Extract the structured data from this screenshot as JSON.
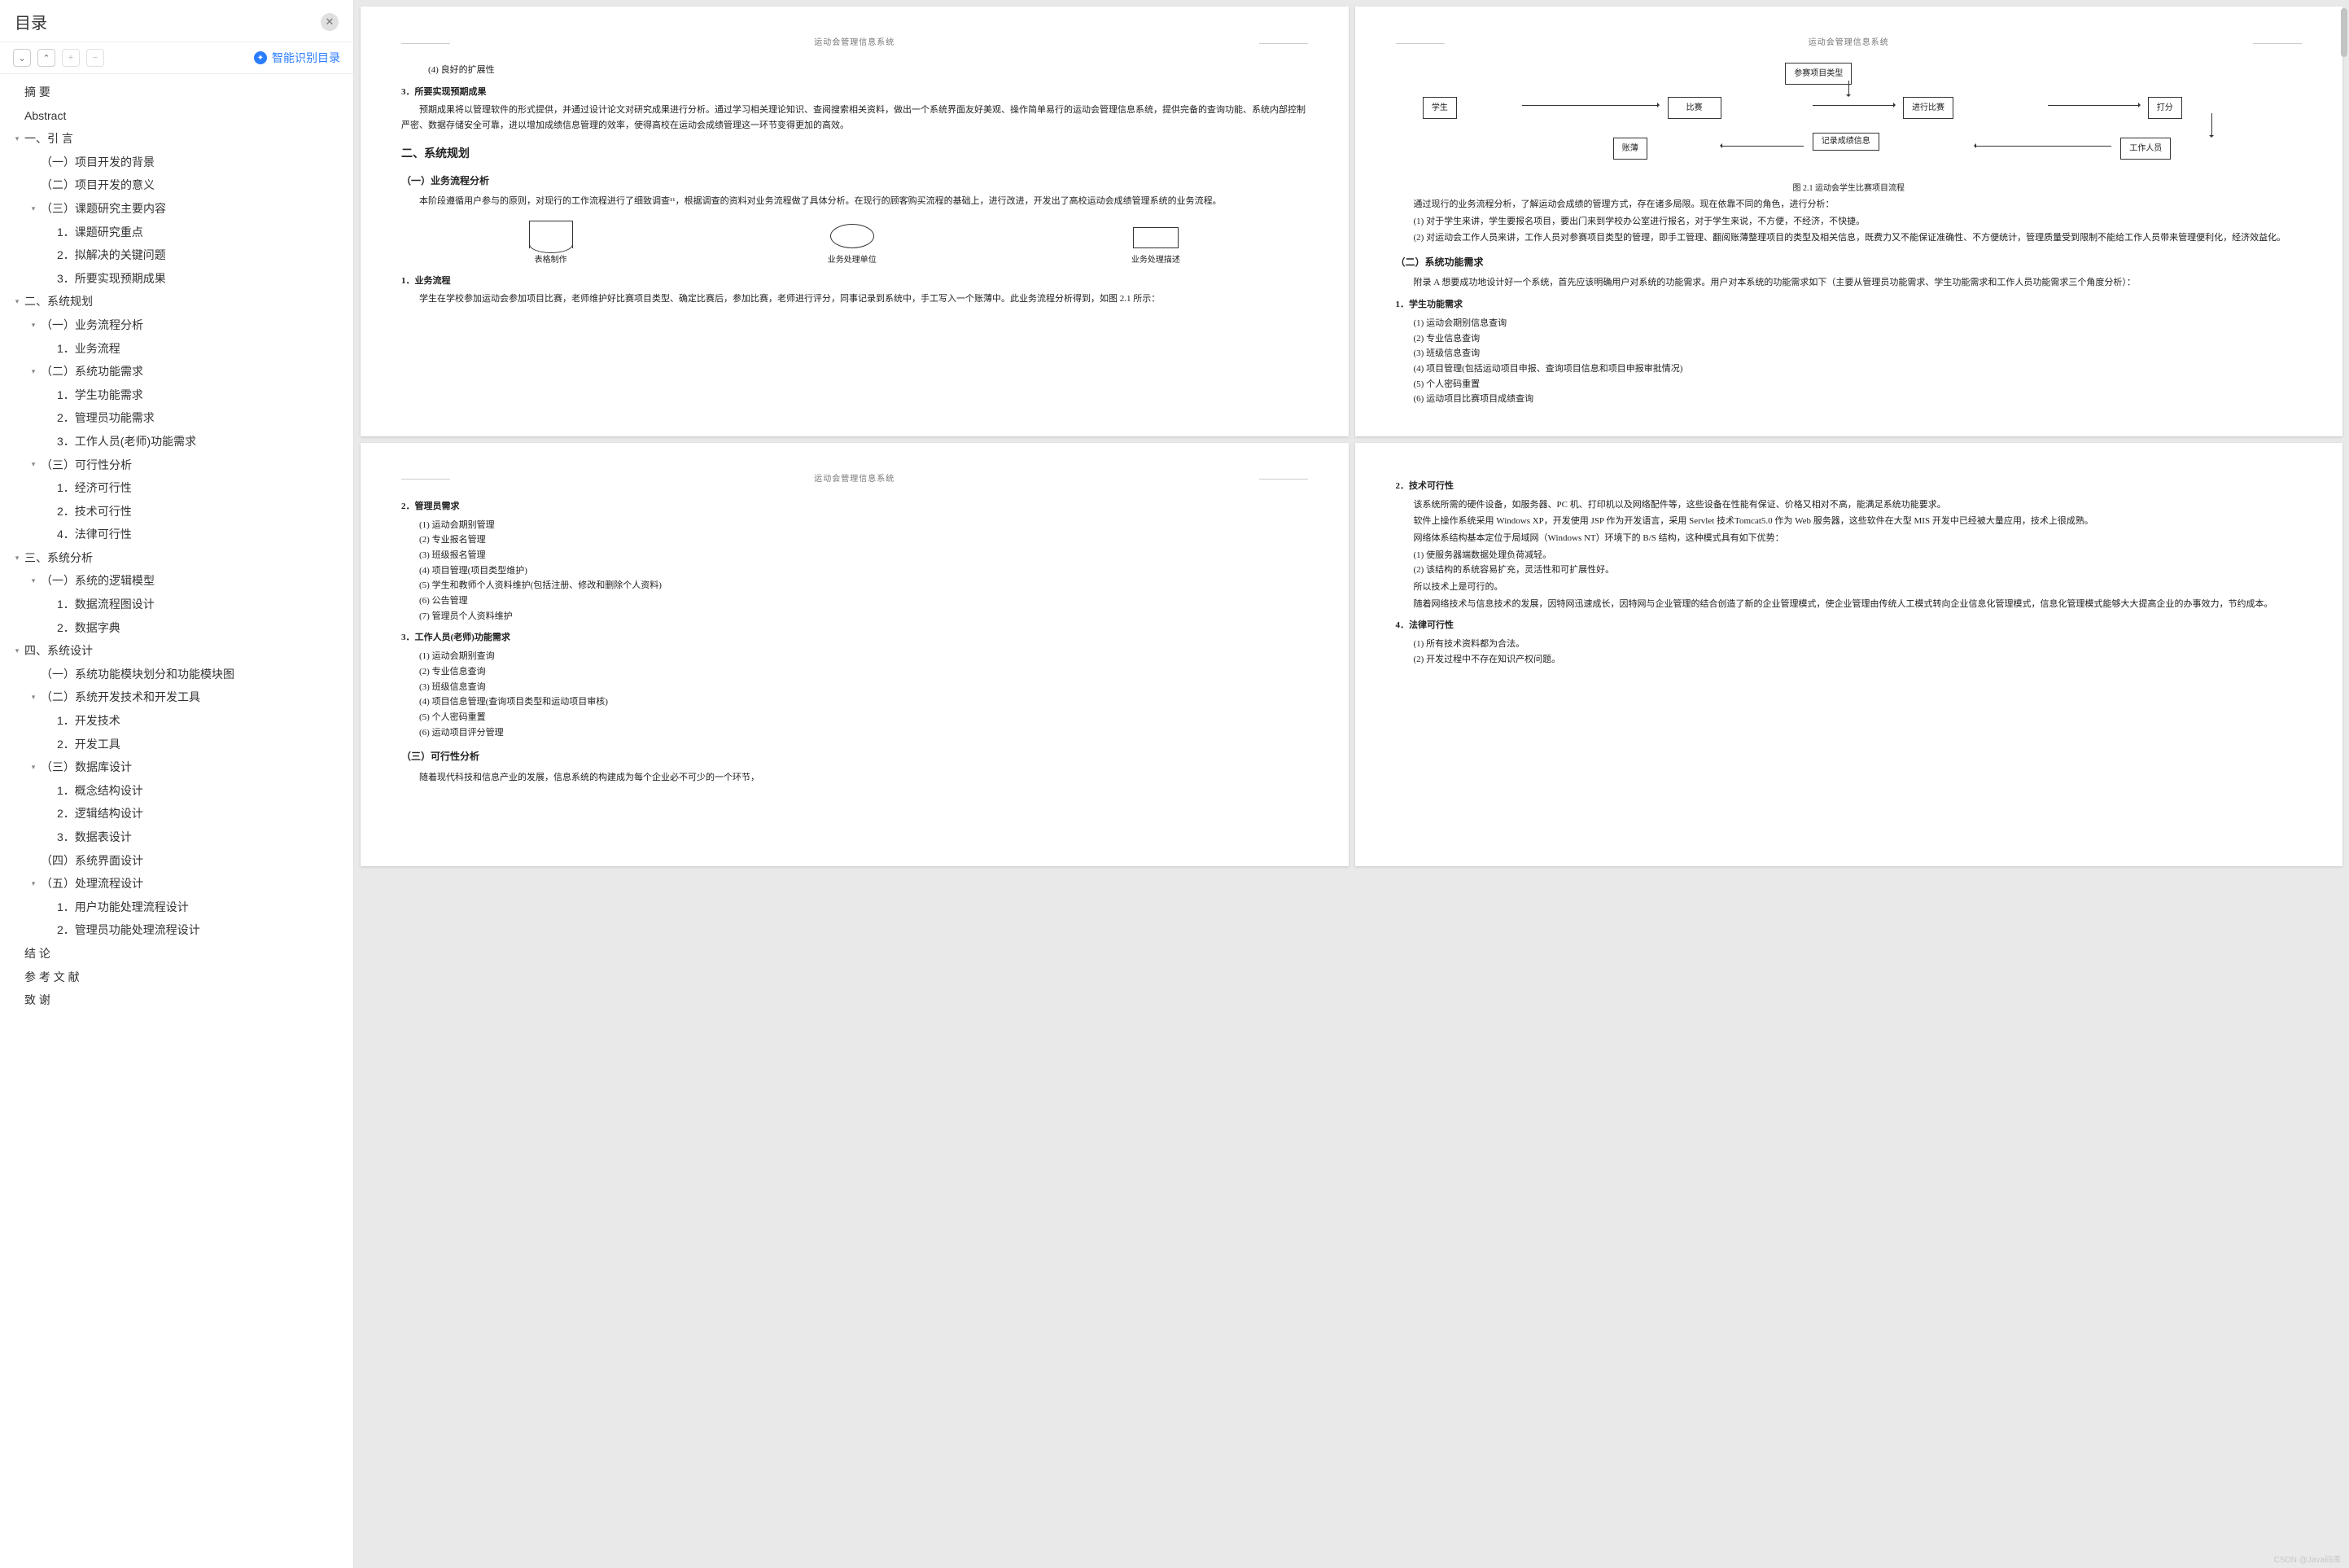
{
  "sidebar": {
    "title": "目录",
    "close_tip": "关闭",
    "smart_link": "智能识别目录",
    "toolbar_icons": {
      "collapse": "⌄",
      "up": "⌃",
      "plus": "+",
      "minus": "−"
    }
  },
  "toc": [
    {
      "label": "摘    要",
      "level": 0,
      "leaf": true,
      "id": "t0"
    },
    {
      "label": "Abstract",
      "level": 0,
      "leaf": true,
      "id": "t1"
    },
    {
      "label": "一、引   言",
      "level": 0,
      "id": "t2",
      "children": [
        {
          "label": "（一）项目开发的背景",
          "leaf": true,
          "id": "t2a"
        },
        {
          "label": "（二）项目开发的意义",
          "leaf": true,
          "id": "t2b"
        },
        {
          "label": "（三）课题研究主要内容",
          "id": "t2c",
          "children": [
            {
              "label": "1．课题研究重点",
              "leaf": true,
              "id": "t2c1"
            },
            {
              "label": "2．拟解决的关键问题",
              "leaf": true,
              "id": "t2c2"
            },
            {
              "label": "3．所要实现预期成果",
              "leaf": true,
              "id": "t2c3"
            }
          ]
        }
      ]
    },
    {
      "label": "二、系统规划",
      "level": 0,
      "id": "t3",
      "children": [
        {
          "label": "（一）业务流程分析",
          "id": "t3a",
          "children": [
            {
              "label": "1．业务流程",
              "leaf": true,
              "id": "t3a1"
            }
          ]
        },
        {
          "label": "（二）系统功能需求",
          "id": "t3b",
          "children": [
            {
              "label": "1．学生功能需求",
              "leaf": true,
              "id": "t3b1"
            },
            {
              "label": "2．管理员功能需求",
              "leaf": true,
              "id": "t3b2"
            },
            {
              "label": "3．工作人员(老师)功能需求",
              "leaf": true,
              "id": "t3b3"
            }
          ]
        },
        {
          "label": "（三）可行性分析",
          "id": "t3c",
          "children": [
            {
              "label": "1．经济可行性",
              "leaf": true,
              "id": "t3c1"
            },
            {
              "label": "2．技术可行性",
              "leaf": true,
              "id": "t3c2"
            },
            {
              "label": "4．法律可行性",
              "leaf": true,
              "id": "t3c4"
            }
          ]
        }
      ]
    },
    {
      "label": "三、系统分析",
      "level": 0,
      "id": "t4",
      "children": [
        {
          "label": "（一）系统的逻辑模型",
          "id": "t4a",
          "children": [
            {
              "label": "1．数据流程图设计",
              "leaf": true,
              "id": "t4a1"
            },
            {
              "label": "2．数据字典",
              "leaf": true,
              "id": "t4a2"
            }
          ]
        }
      ]
    },
    {
      "label": "四、系统设计",
      "level": 0,
      "id": "t5",
      "children": [
        {
          "label": "（一）系统功能模块划分和功能模块图",
          "leaf": true,
          "id": "t5a"
        },
        {
          "label": "（二）系统开发技术和开发工具",
          "id": "t5b",
          "children": [
            {
              "label": "1．开发技术",
              "leaf": true,
              "id": "t5b1"
            },
            {
              "label": "2．开发工具",
              "leaf": true,
              "id": "t5b2"
            }
          ]
        },
        {
          "label": "（三）数据库设计",
          "id": "t5c",
          "children": [
            {
              "label": "1．概念结构设计",
              "leaf": true,
              "id": "t5c1"
            },
            {
              "label": "2．逻辑结构设计",
              "leaf": true,
              "id": "t5c2"
            },
            {
              "label": "3．数据表设计",
              "leaf": true,
              "id": "t5c3"
            }
          ]
        },
        {
          "label": "（四）系统界面设计",
          "leaf": true,
          "id": "t5d"
        },
        {
          "label": "（五）处理流程设计",
          "id": "t5e",
          "children": [
            {
              "label": "1．用户功能处理流程设计",
              "leaf": true,
              "id": "t5e1"
            },
            {
              "label": "2．管理员功能处理流程设计",
              "leaf": true,
              "id": "t5e2"
            }
          ]
        }
      ]
    },
    {
      "label": "结    论",
      "level": 0,
      "leaf": true,
      "id": "t6"
    },
    {
      "label": "参 考 文 献",
      "level": 0,
      "leaf": true,
      "id": "t7"
    },
    {
      "label": "致    谢",
      "level": 0,
      "leaf": true,
      "id": "t8"
    }
  ],
  "doc_header": "运动会管理信息系统",
  "page1": {
    "line_top": "(4) 良好的扩展性",
    "h3a": "3．所要实现预期成果",
    "p1": "预期成果将以管理软件的形式提供，并通过设计论文对研究成果进行分析。通过学习相关理论知识、查阅搜索相关资料，做出一个系统界面友好美观、操作简单易行的运动会管理信息系统，提供完备的查询功能、系统内部控制严密、数据存储安全可靠，进以增加成绩信息管理的效率，使得高校在运动会成绩管理这一环节变得更加的高效。",
    "h2": "二、系统规划",
    "h3b": "（一）业务流程分析",
    "p2": "本阶段遵循用户参与的原则，对现行的工作流程进行了细致调查¹¹，根据调查的资料对业务流程做了具体分析。在现行的顾客购买流程的基础上，进行改进，开发出了高校运动会成绩管理系统的业务流程。",
    "shapes": {
      "a": "表格制作",
      "b": "业务处理单位",
      "c": "业务处理描述"
    },
    "h4": "1．业务流程",
    "p3": "学生在学校参加运动会参加项目比赛，老师维护好比赛项目类型、确定比赛后，参加比赛，老师进行评分，同事记录到系统中，手工写入一个账薄中。此业务流程分析得到，如图 2.1 所示：",
    "corners": true
  },
  "page2": {
    "flow": {
      "top": "参赛项目类型",
      "l1": "学生",
      "l2": "比赛",
      "l3": "进行比赛",
      "l4": "打分",
      "b1": "账薄",
      "b2": "记录成绩信息",
      "b3": "工作人员",
      "caption": "图 2.1 运动会学生比赛项目流程"
    },
    "p1": "通过现行的业务流程分析，了解运动会成绩的管理方式，存在诸多局限。现在依靠不同的角色，进行分析：",
    "li1": "(1) 对于学生来讲，学生要报名项目，要出门来到学校办公室进行报名，对于学生来说，不方便，不经济，不快捷。",
    "li2": "(2) 对运动会工作人员来讲，工作人员对参赛项目类型的管理，即手工管理、翻阅账薄整理项目的类型及相关信息，既费力又不能保证准确性、不方便统计，管理质量受到限制不能给工作人员带来管理便利化，经济效益化。",
    "h3": "（二）系统功能需求",
    "p2": "附录 A 想要成功地设计好一个系统，首先应该明确用户对系统的功能需求。用户对本系统的功能需求如下（主要从管理员功能需求、学生功能需求和工作人员功能需求三个角度分析）：",
    "h4": "1．学生功能需求",
    "ol": [
      "(1) 运动会期别信息查询",
      "(2) 专业信息查询",
      "(3) 班级信息查询",
      "(4) 项目管理(包括运动项目申报、查询项目信息和项目申报审批情况)",
      "(5) 个人密码重置",
      "(6) 运动项目比赛项目成绩查询"
    ],
    "corners": true
  },
  "page3": {
    "h4a": "2．管理员需求",
    "ol_a": [
      "(1) 运动会期别管理",
      "(2) 专业报名管理",
      "(3) 班级报名管理",
      "(4) 项目管理(项目类型维护)",
      "(5) 学生和教师个人资料维护(包括注册、修改和删除个人资料)",
      "(6) 公告管理",
      "(7) 管理员个人资料维护"
    ],
    "h4b": "3．工作人员(老师)功能需求",
    "ol_b": [
      "(1) 运动会期别查询",
      "(2) 专业信息查询",
      "(3) 班级信息查询",
      "(4) 项目信息管理(查询项目类型和运动项目审核)",
      "(5) 个人密码重置",
      "(6) 运动项目评分管理"
    ],
    "h3": "（三）可行性分析",
    "p1": "随着现代科技和信息产业的发展，信息系统的构建成为每个企业必不可少的一个环节，"
  },
  "page4": {
    "h4a": "2．技术可行性",
    "p1": "该系统所需的硬件设备，如服务器、PC 机、打印机以及网络配件等，这些设备在性能有保证、价格又相对不高，能满足系统功能要求。",
    "p2": "软件上操作系统采用 Windows XP，开发使用 JSP 作为开发语言，采用 Servlet 技术Tomcat5.0 作为 Web 服务器，这些软件在大型 MIS 开发中已经被大量应用，技术上很成熟。",
    "p3": "网络体系结构基本定位于局域网（Windows NT）环境下的 B/S 结构，这种模式具有如下优势：",
    "ol_a": [
      "(1) 使服务器端数据处理负荷减轻。",
      "(2) 该结构的系统容易扩充，灵活性和可扩展性好。"
    ],
    "p4": "所以技术上是可行的。",
    "p5": "随着网络技术与信息技术的发展，因特网迅速成长，因特网与企业管理的结合创造了新的企业管理模式，使企业管理由传统人工模式转向企业信息化管理模式，信息化管理模式能够大大提高企业的办事效力，节约成本。",
    "h4b": "4．法律可行性",
    "ol_b": [
      "(1) 所有技术资料都为合法。",
      "(2) 开发过程中不存在知识产权问题。"
    ]
  },
  "watermark": "CSDN @Java码库"
}
